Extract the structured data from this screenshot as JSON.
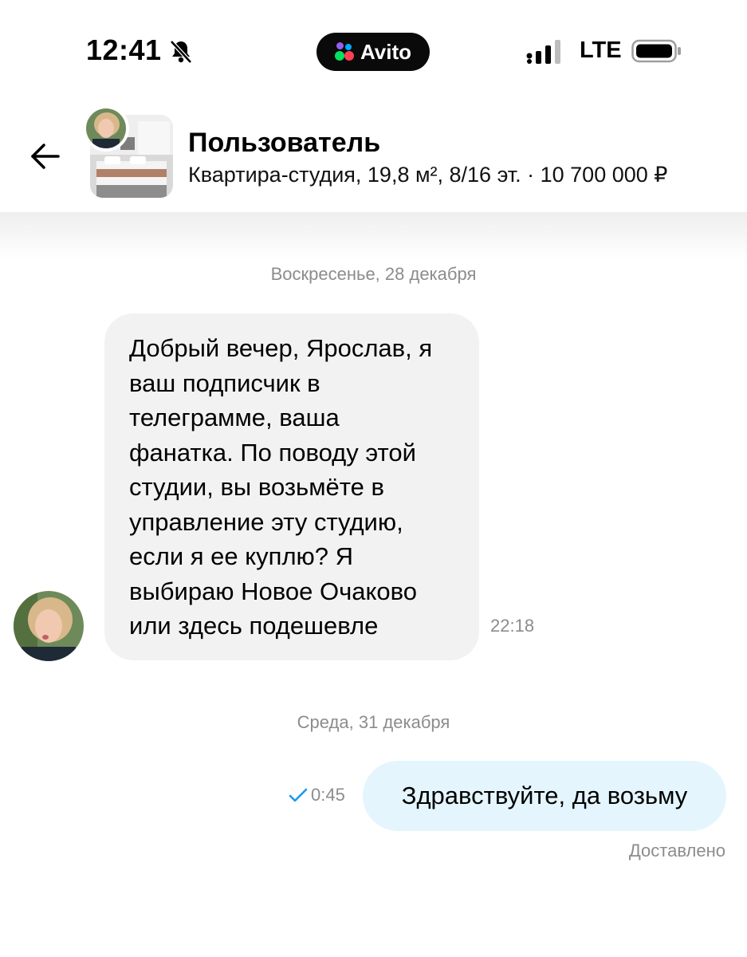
{
  "status_bar": {
    "time": "12:41",
    "app_pill_label": "Avito",
    "network": "LTE"
  },
  "header": {
    "title": "Пользователь",
    "subtitle": "Квартира-студия, 19,8 м², 8/16 эт. · 10 700 000 ₽"
  },
  "chat": {
    "date_separators": [
      "Воскресенье, 28 декабря",
      "Среда, 31 декабря"
    ],
    "incoming": {
      "lines": [
        "Добрый вечер, Ярослав, я",
        "ваш подписчик в",
        "телеграмме, ваша",
        "фанатка. По поводу этой",
        "студии, вы возьмёте в",
        "управление эту студию,",
        "если я ее куплю? Я",
        "выбираю Новое Очаково",
        "или здесь подешевле"
      ],
      "time": "22:18"
    },
    "outgoing": {
      "text": "Здравствуйте, да возьму",
      "time": "0:45",
      "status": "Доставлено"
    }
  },
  "colors": {
    "incoming_bubble": "#f2f2f2",
    "outgoing_bubble": "#e4f5fe",
    "read_check": "#1d9bf0",
    "meta_text": "#8c8c8c",
    "avito_dots": [
      "#04e061",
      "#ff4053",
      "#965eeb",
      "#0af"
    ]
  },
  "icons": {
    "status": [
      "bell-slash-icon",
      "signal-icon",
      "battery-icon"
    ],
    "header": [
      "back-arrow-icon"
    ],
    "message": [
      "check-icon"
    ]
  }
}
